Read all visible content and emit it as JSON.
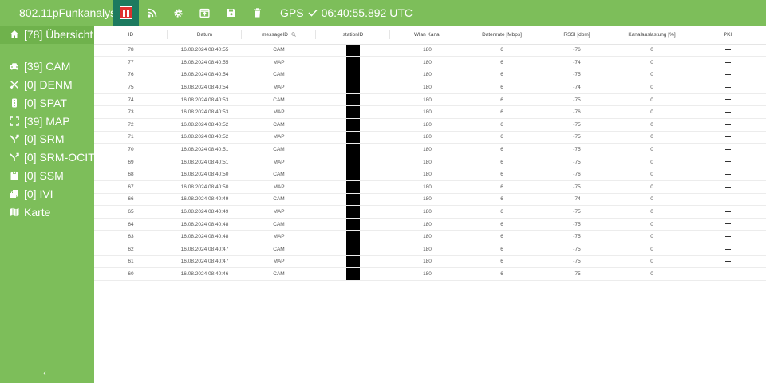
{
  "header": {
    "title": "802.11pFunkanalyse",
    "gps_label": "GPS",
    "gps_time": "06:40:55.892 UTC",
    "icons": [
      "pause-icon",
      "rss-icon",
      "gear-icon",
      "export-icon",
      "save-icon",
      "trash-icon",
      "check-icon"
    ]
  },
  "sidebar": {
    "items": [
      {
        "label": "[78] Übersicht",
        "icon": "home-icon"
      },
      {
        "label": "[39] CAM",
        "icon": "car-icon"
      },
      {
        "label": "[0] DENM",
        "icon": "tools-icon"
      },
      {
        "label": "[0] SPAT",
        "icon": "traffic-light-icon"
      },
      {
        "label": "[39] MAP",
        "icon": "map-expand-icon"
      },
      {
        "label": "[0] SRM",
        "icon": "fork-icon"
      },
      {
        "label": "[0] SRM-OCIT",
        "icon": "fork-icon"
      },
      {
        "label": "[0] SSM",
        "icon": "badge-icon"
      },
      {
        "label": "[0] IVI",
        "icon": "layers-icon"
      },
      {
        "label": "Karte",
        "icon": "map-icon"
      }
    ],
    "collapse_label": "‹"
  },
  "table": {
    "columns": [
      "ID",
      "Datum",
      "messageID",
      "stationID",
      "Wlan Kanal",
      "Datenrate [Mbps]",
      "RSSI [dbm]",
      "Kanalauslastung [%]",
      "PKI"
    ],
    "rows": [
      [
        "78",
        "16.08.2024 08:40:55",
        "CAM",
        "",
        "180",
        "6",
        "-76",
        "0",
        ""
      ],
      [
        "77",
        "16.08.2024 08:40:55",
        "MAP",
        "",
        "180",
        "6",
        "-74",
        "0",
        ""
      ],
      [
        "76",
        "16.08.2024 08:40:54",
        "CAM",
        "",
        "180",
        "6",
        "-75",
        "0",
        ""
      ],
      [
        "75",
        "16.08.2024 08:40:54",
        "MAP",
        "",
        "180",
        "6",
        "-74",
        "0",
        ""
      ],
      [
        "74",
        "16.08.2024 08:40:53",
        "CAM",
        "",
        "180",
        "6",
        "-75",
        "0",
        ""
      ],
      [
        "73",
        "16.08.2024 08:40:53",
        "MAP",
        "",
        "180",
        "6",
        "-76",
        "0",
        ""
      ],
      [
        "72",
        "16.08.2024 08:40:52",
        "CAM",
        "",
        "180",
        "6",
        "-75",
        "0",
        ""
      ],
      [
        "71",
        "16.08.2024 08:40:52",
        "MAP",
        "",
        "180",
        "6",
        "-75",
        "0",
        ""
      ],
      [
        "70",
        "16.08.2024 08:40:51",
        "CAM",
        "",
        "180",
        "6",
        "-75",
        "0",
        ""
      ],
      [
        "69",
        "16.08.2024 08:40:51",
        "MAP",
        "",
        "180",
        "6",
        "-75",
        "0",
        ""
      ],
      [
        "68",
        "16.08.2024 08:40:50",
        "CAM",
        "",
        "180",
        "6",
        "-76",
        "0",
        ""
      ],
      [
        "67",
        "16.08.2024 08:40:50",
        "MAP",
        "",
        "180",
        "6",
        "-75",
        "0",
        ""
      ],
      [
        "66",
        "16.08.2024 08:40:49",
        "CAM",
        "",
        "180",
        "6",
        "-74",
        "0",
        ""
      ],
      [
        "65",
        "16.08.2024 08:40:49",
        "MAP",
        "",
        "180",
        "6",
        "-75",
        "0",
        ""
      ],
      [
        "64",
        "16.08.2024 08:40:48",
        "CAM",
        "",
        "180",
        "6",
        "-75",
        "0",
        ""
      ],
      [
        "63",
        "16.08.2024 08:40:48",
        "MAP",
        "",
        "180",
        "6",
        "-75",
        "0",
        ""
      ],
      [
        "62",
        "16.08.2024 08:40:47",
        "CAM",
        "",
        "180",
        "6",
        "-75",
        "0",
        ""
      ],
      [
        "61",
        "16.08.2024 08:40:47",
        "MAP",
        "",
        "180",
        "6",
        "-75",
        "0",
        ""
      ],
      [
        "60",
        "16.08.2024 08:40:46",
        "CAM",
        "",
        "180",
        "6",
        "-75",
        "0",
        ""
      ]
    ]
  },
  "colors": {
    "bar": "#7dbe5a",
    "sidebar_active": "#6fb24c",
    "pause_bg": "#1d7a5f",
    "pause_button": "#e0312f"
  }
}
